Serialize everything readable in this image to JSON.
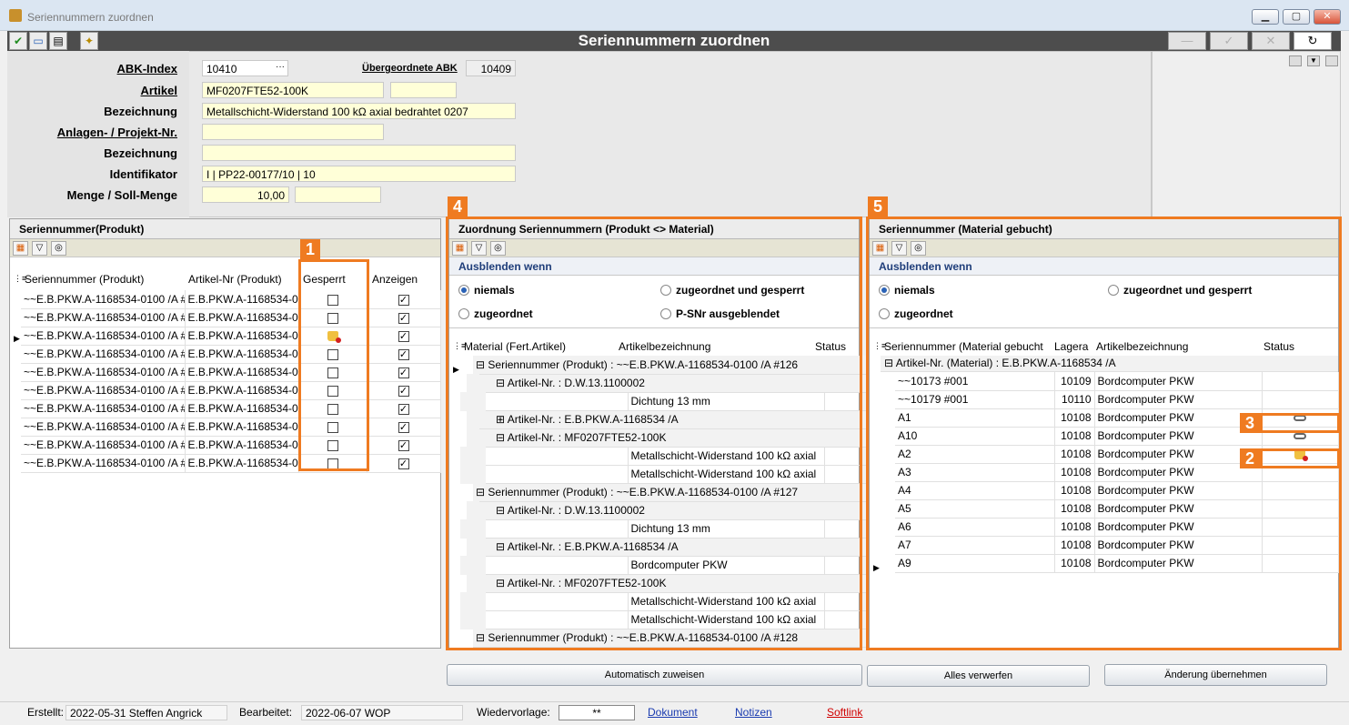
{
  "window": {
    "title": "Seriennummern zuordnen",
    "heading": "Seriennummern zuordnen"
  },
  "header": {
    "abk_label": "ABK-Index",
    "abk_value": "10410",
    "ueber_label": "Übergeordnete ABK",
    "ueber_value": "10409",
    "artikel_label": "Artikel",
    "artikel_value": "MF0207FTE52-100K",
    "bez_label": "Bezeichnung",
    "bez_value": "Metallschicht-Widerstand 100 kΩ axial bedrahtet 0207",
    "anlagen_label": "Anlagen- / Projekt-Nr.",
    "bez2_label": "Bezeichnung",
    "ident_label": "Identifikator",
    "ident_value": "I | PP22-00177/10 | 10",
    "menge_label": "Menge / Soll-Menge",
    "menge_value": "10,00"
  },
  "left": {
    "title": "Seriennummer(Produkt)",
    "col1": "Seriennummer (Produkt)",
    "col2": "Artikel-Nr (Produkt)",
    "col3": "Gesperrt",
    "col4": "Anzeigen",
    "rows": [
      {
        "sn": "~~E.B.PKW.A-1168534-0100 /A #",
        "art": "E.B.PKW.A-1168534-0"
      },
      {
        "sn": "~~E.B.PKW.A-1168534-0100 /A #",
        "art": "E.B.PKW.A-1168534-0"
      },
      {
        "sn": "~~E.B.PKW.A-1168534-0100 /A #",
        "art": "E.B.PKW.A-1168534-0"
      },
      {
        "sn": "~~E.B.PKW.A-1168534-0100 /A #",
        "art": "E.B.PKW.A-1168534-0"
      },
      {
        "sn": "~~E.B.PKW.A-1168534-0100 /A #",
        "art": "E.B.PKW.A-1168534-0"
      },
      {
        "sn": "~~E.B.PKW.A-1168534-0100 /A #",
        "art": "E.B.PKW.A-1168534-0"
      },
      {
        "sn": "~~E.B.PKW.A-1168534-0100 /A #",
        "art": "E.B.PKW.A-1168534-0"
      },
      {
        "sn": "~~E.B.PKW.A-1168534-0100 /A #",
        "art": "E.B.PKW.A-1168534-0"
      },
      {
        "sn": "~~E.B.PKW.A-1168534-0100 /A #",
        "art": "E.B.PKW.A-1168534-0"
      },
      {
        "sn": "~~E.B.PKW.A-1168534-0100 /A #",
        "art": "E.B.PKW.A-1168534-0"
      }
    ]
  },
  "middle": {
    "title": "Zuordnung Seriennummern (Produkt <> Material)",
    "ausblenden": "Ausblenden wenn",
    "r1": "niemals",
    "r2": "zugeordnet und gesperrt",
    "r3": "zugeordnet",
    "r4": "P-SNr ausgeblendet",
    "col1": "Material (Fert.Artikel)",
    "col2": "Artikelbezeichnung",
    "col3": "Status",
    "tree": [
      {
        "lvl": 0,
        "txt": "Seriennummer (Produkt) : ~~E.B.PKW.A-1168534-0100 /A #126",
        "bez": "",
        "sign": "⊟"
      },
      {
        "lvl": 1,
        "txt": "Artikel-Nr. : D.W.13.1100002",
        "bez": "",
        "sign": "⊟"
      },
      {
        "lvl": 2,
        "txt": "",
        "bez": "Dichtung 13 mm",
        "sign": ""
      },
      {
        "lvl": 1,
        "txt": "Artikel-Nr. : E.B.PKW.A-1168534 /A",
        "bez": "",
        "sign": "⊞"
      },
      {
        "lvl": 1,
        "txt": "Artikel-Nr. : MF0207FTE52-100K",
        "bez": "",
        "sign": "⊟"
      },
      {
        "lvl": 2,
        "txt": "",
        "bez": "Metallschicht-Widerstand 100 kΩ axial",
        "sign": ""
      },
      {
        "lvl": 2,
        "txt": "",
        "bez": "Metallschicht-Widerstand 100 kΩ axial",
        "sign": ""
      },
      {
        "lvl": 0,
        "txt": "Seriennummer (Produkt) : ~~E.B.PKW.A-1168534-0100 /A #127",
        "bez": "",
        "sign": "⊟"
      },
      {
        "lvl": 1,
        "txt": "Artikel-Nr. : D.W.13.1100002",
        "bez": "",
        "sign": "⊟"
      },
      {
        "lvl": 2,
        "txt": "",
        "bez": "Dichtung 13 mm",
        "sign": ""
      },
      {
        "lvl": 1,
        "txt": "Artikel-Nr. : E.B.PKW.A-1168534 /A",
        "bez": "",
        "sign": "⊟"
      },
      {
        "lvl": 2,
        "txt": "",
        "bez": "Bordcomputer PKW",
        "sign": ""
      },
      {
        "lvl": 1,
        "txt": "Artikel-Nr. : MF0207FTE52-100K",
        "bez": "",
        "sign": "⊟"
      },
      {
        "lvl": 2,
        "txt": "",
        "bez": "Metallschicht-Widerstand 100 kΩ axial",
        "sign": ""
      },
      {
        "lvl": 2,
        "txt": "",
        "bez": "Metallschicht-Widerstand 100 kΩ axial",
        "sign": ""
      },
      {
        "lvl": 0,
        "txt": "Seriennummer (Produkt) : ~~E.B.PKW.A-1168534-0100 /A #128",
        "bez": "",
        "sign": "⊟"
      }
    ]
  },
  "right": {
    "title": "Seriennummer (Material gebucht)",
    "ausblenden": "Ausblenden wenn",
    "r1": "niemals",
    "r2": "zugeordnet und gesperrt",
    "r3": "zugeordnet",
    "col1": "Seriennummer (Material gebucht",
    "col2": "Lagera",
    "col3": "Artikelbezeichnung",
    "col4": "Status",
    "group": "Artikel-Nr. (Material) : E.B.PKW.A-1168534 /A",
    "rows": [
      {
        "sn": "~~10173 #001",
        "lager": "10109",
        "bez": "Bordcomputer PKW",
        "status": ""
      },
      {
        "sn": "~~10179 #001",
        "lager": "10110",
        "bez": "Bordcomputer PKW",
        "status": ""
      },
      {
        "sn": "A1",
        "lager": "10108",
        "bez": "Bordcomputer PKW",
        "status": "link"
      },
      {
        "sn": "A10",
        "lager": "10108",
        "bez": "Bordcomputer PKW",
        "status": "link"
      },
      {
        "sn": "A2",
        "lager": "10108",
        "bez": "Bordcomputer PKW",
        "status": "lock"
      },
      {
        "sn": "A3",
        "lager": "10108",
        "bez": "Bordcomputer PKW",
        "status": ""
      },
      {
        "sn": "A4",
        "lager": "10108",
        "bez": "Bordcomputer PKW",
        "status": ""
      },
      {
        "sn": "A5",
        "lager": "10108",
        "bez": "Bordcomputer PKW",
        "status": ""
      },
      {
        "sn": "A6",
        "lager": "10108",
        "bez": "Bordcomputer PKW",
        "status": ""
      },
      {
        "sn": "A7",
        "lager": "10108",
        "bez": "Bordcomputer PKW",
        "status": ""
      },
      {
        "sn": "A9",
        "lager": "10108",
        "bez": "Bordcomputer PKW",
        "status": ""
      }
    ]
  },
  "badges": {
    "b1": "1",
    "b2": "2",
    "b3": "3",
    "b4": "4",
    "b5": "5"
  },
  "buttons": {
    "auto": "Automatisch zuweisen",
    "verwerfen": "Alles verwerfen",
    "uebernehmen": "Änderung übernehmen"
  },
  "statusbar": {
    "erstellt_label": "Erstellt:",
    "erstellt_value": "2022-05-31  Steffen Angrick",
    "bearbeitet_label": "Bearbeitet:",
    "bearbeitet_value": "2022-06-07  WOP",
    "wiedervorlage_label": "Wiedervorlage:",
    "wiedervorlage_value": "**",
    "dokument": "Dokument",
    "notizen": "Notizen",
    "softlink": "Softlink"
  },
  "colors": {
    "accent": "#ef7b21",
    "toolbar": "#4d4d4d",
    "field": "#ffffd8",
    "softlink": "#d00000",
    "link": "#1a3bb0"
  }
}
